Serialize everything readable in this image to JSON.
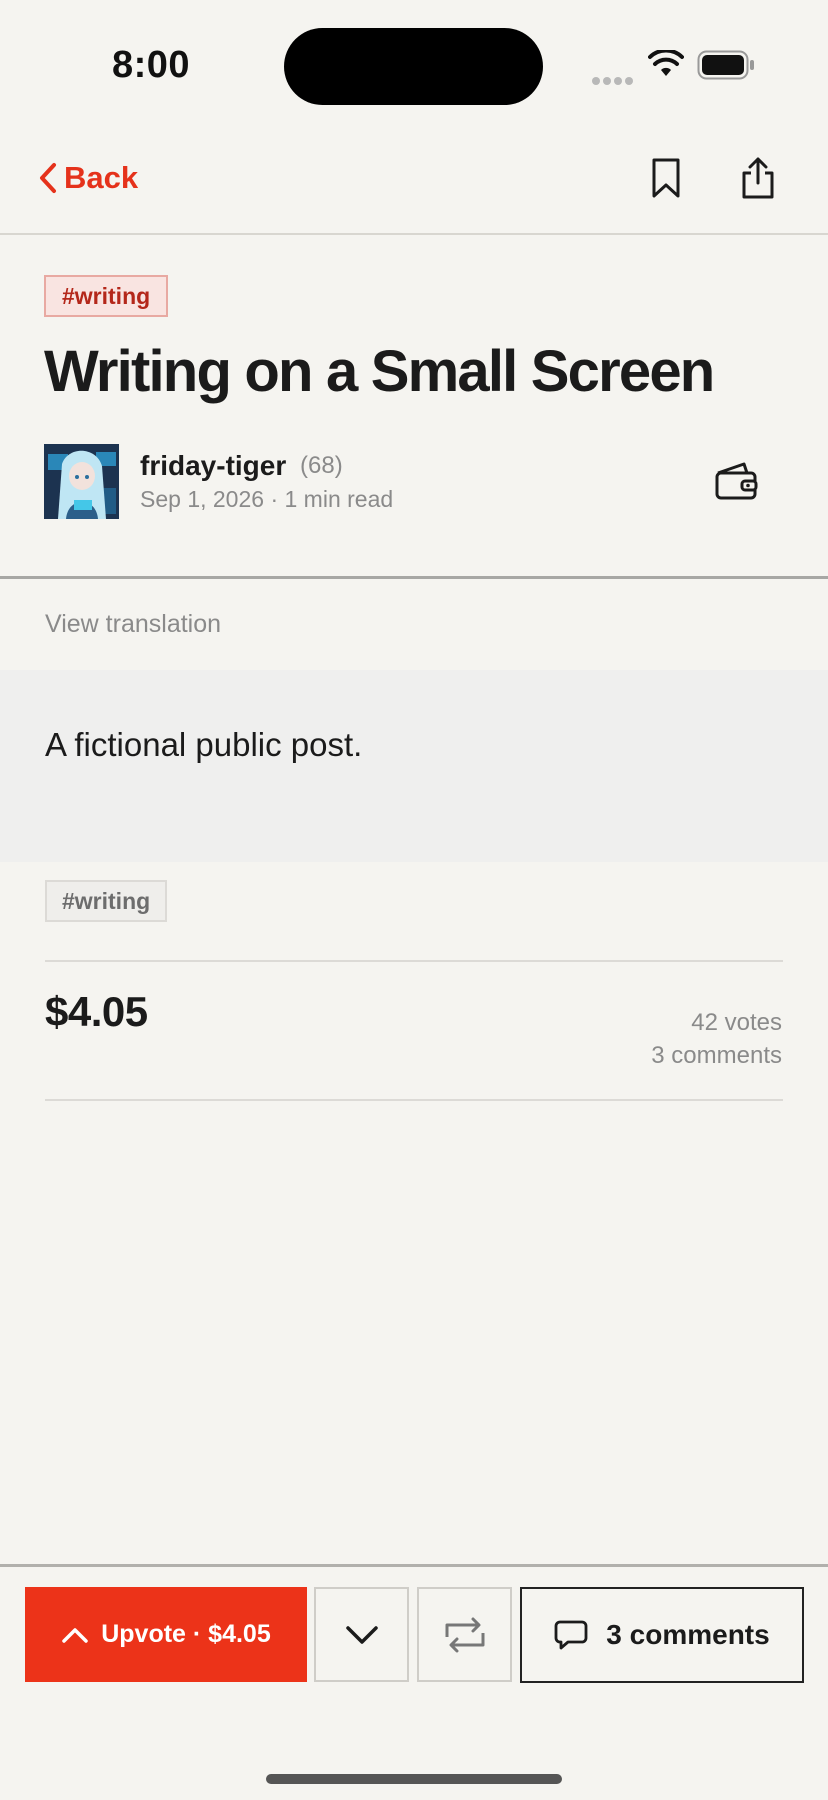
{
  "status_bar": {
    "time": "8:00"
  },
  "nav": {
    "back_label": "Back"
  },
  "post": {
    "tag": "#writing",
    "title": "Writing on a Small Screen",
    "author": "friday-tiger",
    "reputation": "(68)",
    "meta": "Sep 1, 2026 · 1 min read",
    "view_translation": "View translation",
    "body": "A fictional public post.",
    "footer_tag": "#writing",
    "payout": "$4.05",
    "votes": "42 votes",
    "comments_count": "3 comments"
  },
  "actions": {
    "upvote_label": "Upvote · $4.05",
    "comments_label": "3 comments"
  },
  "colors": {
    "accent": "#ec3319",
    "background": "#f5f4f0",
    "text": "#1b1b1b",
    "muted": "#8a8a8a"
  },
  "icons": [
    "chevron-left-icon",
    "bookmark-icon",
    "share-icon",
    "wallet-icon",
    "chevron-up-icon",
    "chevron-down-icon",
    "repost-icon",
    "comment-icon",
    "wifi-icon",
    "battery-icon"
  ]
}
